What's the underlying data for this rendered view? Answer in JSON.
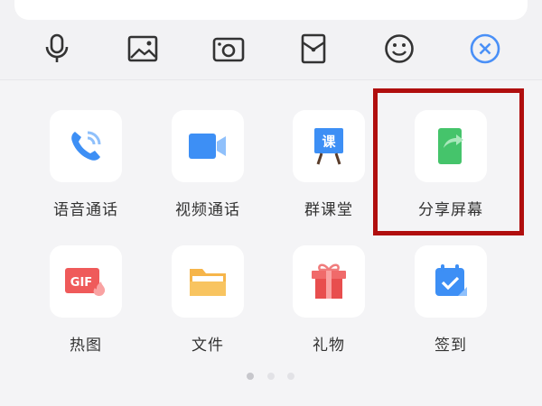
{
  "toolbar": {
    "items": [
      {
        "name": "voice-input-button",
        "icon": "microphone-icon"
      },
      {
        "name": "image-button",
        "icon": "image-icon"
      },
      {
        "name": "camera-button",
        "icon": "camera-icon"
      },
      {
        "name": "red-packet-button",
        "icon": "red-packet-icon"
      },
      {
        "name": "emoji-button",
        "icon": "smiley-icon"
      },
      {
        "name": "close-panel-button",
        "icon": "close-icon"
      }
    ]
  },
  "panel": {
    "items": [
      {
        "label": "语音通话",
        "icon": "phone-call-icon"
      },
      {
        "label": "视频通话",
        "icon": "video-call-icon"
      },
      {
        "label": "群课堂",
        "icon": "classroom-icon",
        "icon_text": "课"
      },
      {
        "label": "分享屏幕",
        "icon": "share-screen-icon"
      },
      {
        "label": "热图",
        "icon": "gif-icon",
        "icon_text": "GIF"
      },
      {
        "label": "文件",
        "icon": "folder-icon"
      },
      {
        "label": "礼物",
        "icon": "gift-icon"
      },
      {
        "label": "签到",
        "icon": "check-in-icon"
      }
    ],
    "highlighted_item": "分享屏幕"
  },
  "pagination": {
    "pages": 3,
    "current": 1
  },
  "colors": {
    "accent": "#4a90f7",
    "highlight": "#b00e0e",
    "green": "#45c46b",
    "red": "#ef5a5a",
    "orange": "#f6b54a"
  }
}
